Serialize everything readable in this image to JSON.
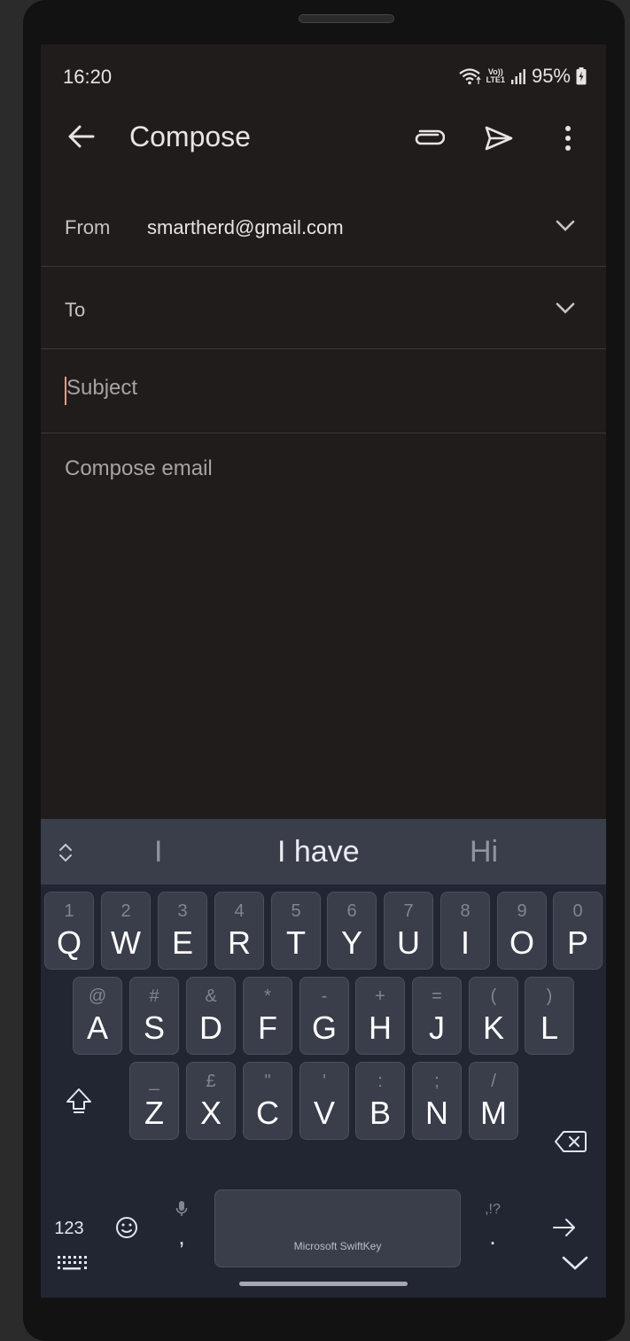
{
  "status_bar": {
    "time": "16:20",
    "network_top": "Vo))",
    "network_bottom": "LTE1",
    "battery": "95%"
  },
  "app_bar": {
    "title": "Compose"
  },
  "from": {
    "label": "From",
    "value": "smartherd@gmail.com"
  },
  "to": {
    "label": "To",
    "value": ""
  },
  "subject": {
    "placeholder": "Subject",
    "value": ""
  },
  "body": {
    "placeholder": "Compose email",
    "value": ""
  },
  "keyboard": {
    "suggestions": [
      "I",
      "I have",
      "Hi"
    ],
    "row1": [
      {
        "hint": "1",
        "key": "Q"
      },
      {
        "hint": "2",
        "key": "W"
      },
      {
        "hint": "3",
        "key": "E"
      },
      {
        "hint": "4",
        "key": "R"
      },
      {
        "hint": "5",
        "key": "T"
      },
      {
        "hint": "6",
        "key": "Y"
      },
      {
        "hint": "7",
        "key": "U"
      },
      {
        "hint": "8",
        "key": "I"
      },
      {
        "hint": "9",
        "key": "O"
      },
      {
        "hint": "0",
        "key": "P"
      }
    ],
    "row2": [
      {
        "hint": "@",
        "key": "A"
      },
      {
        "hint": "#",
        "key": "S"
      },
      {
        "hint": "&",
        "key": "D"
      },
      {
        "hint": "*",
        "key": "F"
      },
      {
        "hint": "-",
        "key": "G"
      },
      {
        "hint": "+",
        "key": "H"
      },
      {
        "hint": "=",
        "key": "J"
      },
      {
        "hint": "(",
        "key": "K"
      },
      {
        "hint": ")",
        "key": "L"
      }
    ],
    "row3": [
      {
        "hint": "_",
        "key": "Z"
      },
      {
        "hint": "£",
        "key": "X"
      },
      {
        "hint": "\"",
        "key": "C"
      },
      {
        "hint": "'",
        "key": "V"
      },
      {
        "hint": ":",
        "key": "B"
      },
      {
        "hint": ";",
        "key": "N"
      },
      {
        "hint": "/",
        "key": "M"
      }
    ],
    "numbers_key": "123",
    "comma_key": ",",
    "space_label": "Microsoft SwiftKey",
    "period_hint": ",!?",
    "period_key": "."
  },
  "colors": {
    "background": "#201c1b",
    "keyboard": "#222633",
    "key": "#3a3e4a",
    "cursor": "#f29b83"
  }
}
